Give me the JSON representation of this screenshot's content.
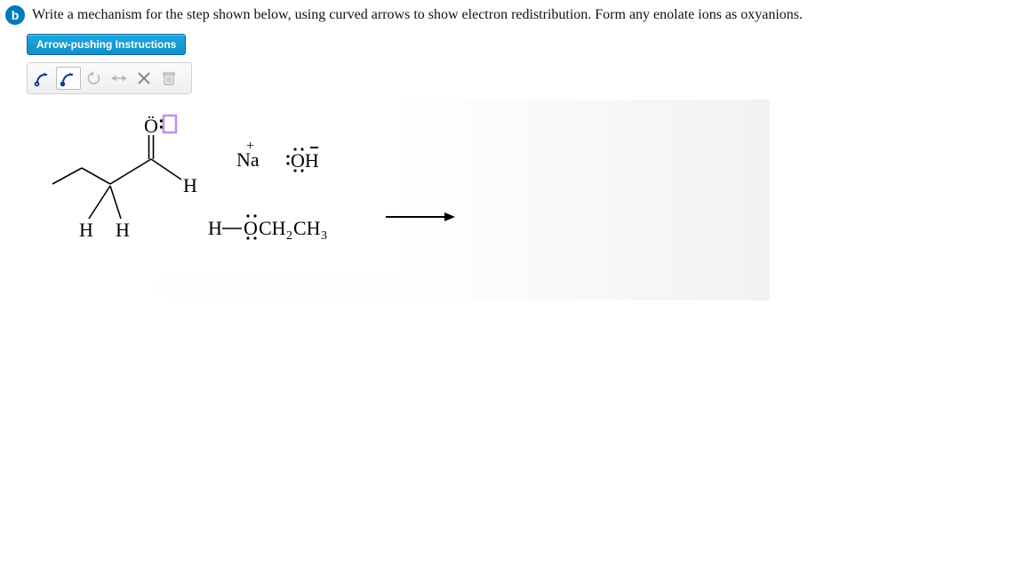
{
  "header": {
    "part_label": "b",
    "question": "Write a mechanism for the step shown below, using curved arrows to show electron redistribution. Form any enolate ions as oxyanions."
  },
  "instructions_button": "Arrow-pushing Instructions",
  "toolbar": {
    "tools": [
      {
        "name": "curved-arrow-single-start",
        "selected": false
      },
      {
        "name": "curved-arrow-double-start",
        "selected": true
      },
      {
        "name": "undo",
        "disabled": true
      },
      {
        "name": "resonance-toggle",
        "disabled": true
      },
      {
        "name": "clear",
        "disabled": false
      },
      {
        "name": "delete",
        "disabled": true
      }
    ]
  },
  "canvas": {
    "atoms": {
      "carbonyl_O": "Ö",
      "aldehyde_H": "H",
      "alpha_H1": "H",
      "alpha_H2": "H",
      "Na_plus_label": "Na",
      "Na_plus_charge": "+",
      "OH_neg_label": "OH",
      "ethanol_H": "H",
      "ethanol_O_frag": "OCH",
      "ethanol_CH3_frag": "CH",
      "ethanol_sub2": "2",
      "ethanol_sub3": "3"
    },
    "lone_pair_selected": true
  }
}
